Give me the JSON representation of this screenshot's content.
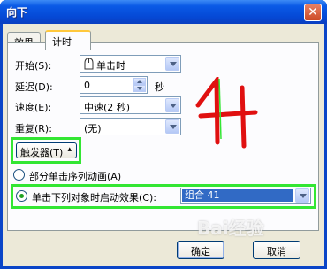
{
  "window": {
    "title": "向下"
  },
  "tabs": [
    {
      "label": "效果"
    },
    {
      "label": "计时"
    }
  ],
  "timing": {
    "start_label": "开始(S):",
    "start_value": "单击时",
    "delay_label": "延迟(D):",
    "delay_value": "0",
    "delay_unit": "秒",
    "speed_label": "速度(E):",
    "speed_value": "中速(2 秒)",
    "repeat_label": "重复(R):",
    "repeat_value": "(无)"
  },
  "triggers": {
    "button_label": "触发器(T)",
    "option_sequence": "部分单击序列动画(A)",
    "option_on_click": "单击下列对象时启动效果(C):",
    "selected_object": "组合 41"
  },
  "buttons": {
    "ok": "确定",
    "cancel": "取消"
  },
  "watermark_text": "Bai经验",
  "colors": {
    "highlight": "#33e633",
    "annotation": "#e01010"
  }
}
